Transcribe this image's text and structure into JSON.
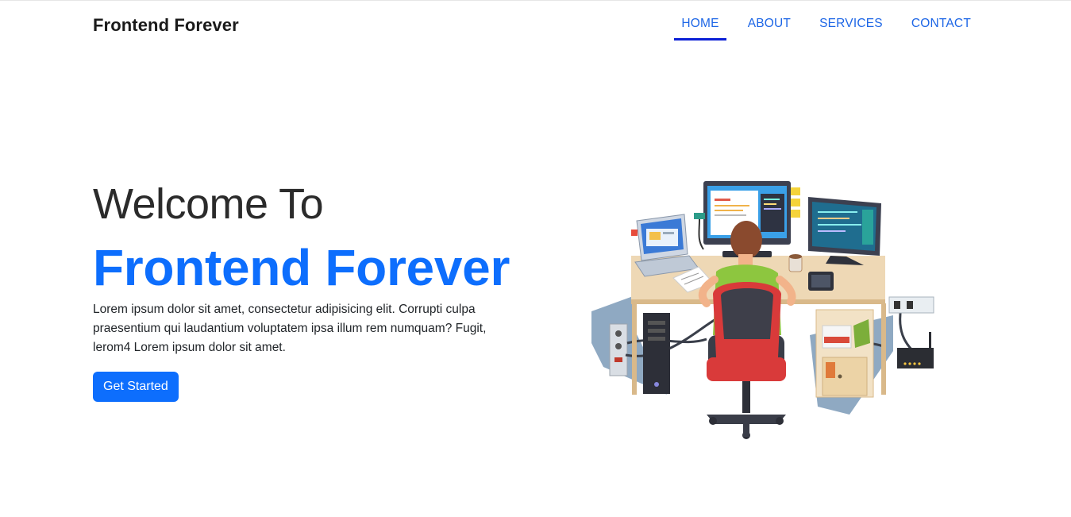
{
  "navbar": {
    "brand": "Frontend Forever",
    "links": [
      {
        "label": "HOME",
        "active": true
      },
      {
        "label": "ABOUT",
        "active": false
      },
      {
        "label": "SERVICES",
        "active": false
      },
      {
        "label": "CONTACT",
        "active": false
      }
    ]
  },
  "hero": {
    "welcome": "Welcome To",
    "title": "Frontend Forever",
    "description": "Lorem ipsum dolor sit amet, consectetur adipisicing elit. Corrupti culpa praesentium qui laudantium voluptatem ipsa illum rem numquam? Fugit, lerom4 Lorem ipsum dolor sit amet.",
    "cta_label": "Get Started"
  },
  "colors": {
    "accent": "#0d6efd",
    "nav_link": "#1d66e6",
    "active_underline": "#0a1fd6"
  },
  "illustration": {
    "subject": "developer-at-desk-illustration"
  }
}
